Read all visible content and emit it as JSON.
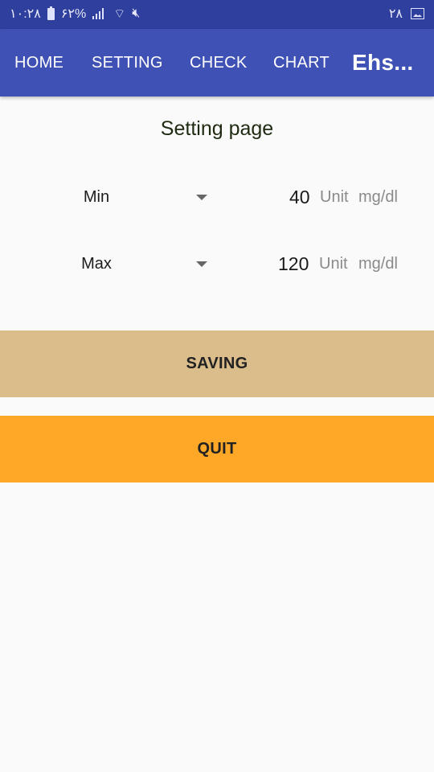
{
  "status_bar": {
    "time": "۱۰:۲۸",
    "battery": "۶۲%",
    "date": "۲۸"
  },
  "tabs": [
    {
      "label": "HOME"
    },
    {
      "label": "SETTING"
    },
    {
      "label": "CHECK"
    },
    {
      "label": "CHART"
    }
  ],
  "app_title": "Ehs...",
  "page": {
    "title": "Setting page",
    "rows": [
      {
        "spinner": "Min",
        "value": "40",
        "unit_label": "Unit",
        "unit": "mg/dl"
      },
      {
        "spinner": "Max",
        "value": "120",
        "unit_label": "Unit",
        "unit": "mg/dl"
      }
    ]
  },
  "buttons": {
    "save_label": "SAVING",
    "quit_label": "QUIT"
  },
  "colors": {
    "status_bar": "#2f3f9e",
    "toolbar": "#3f51b5",
    "saving_button": "#dbbd8c",
    "quit_button": "#ffa726"
  }
}
